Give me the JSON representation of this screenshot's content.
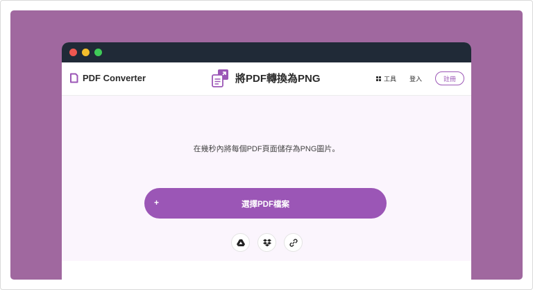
{
  "header": {
    "brand": "PDF Converter",
    "title": "將PDF轉換為PNG",
    "tools_label": "工具",
    "login_label": "登入",
    "signup_label": "註冊"
  },
  "main": {
    "subtitle": "在幾秒內將每個PDF頁面儲存為PNG圖片。",
    "upload_plus": "+",
    "upload_label": "選擇PDF檔案"
  },
  "icons": {
    "brand": "file-icon",
    "title": "pdf-convert-icon",
    "tools": "grid-icon",
    "google_drive": "google-drive-icon",
    "dropbox": "dropbox-icon",
    "link": "link-icon"
  },
  "colors": {
    "accent": "#9b56b6",
    "background_outer": "#a0689f",
    "titlebar": "#202a37",
    "content_bg": "#fbf5fd"
  }
}
